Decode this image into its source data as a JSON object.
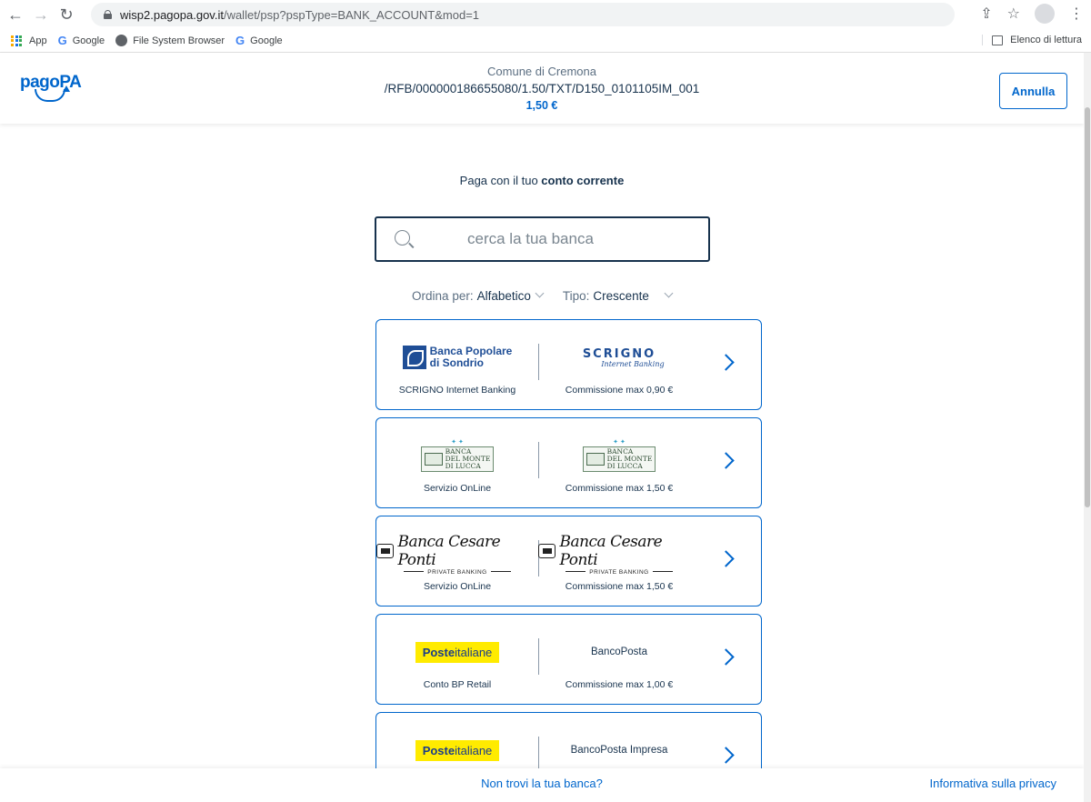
{
  "browser": {
    "url_host": "wisp2.pagopa.gov.it",
    "url_path": "/wallet/psp?pspType=BANK_ACCOUNT&mod=1",
    "bookmarks": [
      "App",
      "Google",
      "File System Browser",
      "Google"
    ],
    "reading_list": "Elenco di lettura"
  },
  "header": {
    "logo_text": "pagoPA",
    "entity": "Comune di Cremona",
    "subject": "/RFB/000000186655080/1.50/TXT/D150_0101105IM_001",
    "amount": "1,50 €",
    "cancel_label": "Annulla"
  },
  "intro": {
    "prefix": "Paga con il tuo ",
    "bold": "conto corrente"
  },
  "search": {
    "placeholder": "cerca la tua banca"
  },
  "sort": {
    "order_label": "Ordina per:",
    "order_value": "Alfabetico",
    "type_label": "Tipo:",
    "type_value": "Crescente"
  },
  "cards": [
    {
      "bank": "Banca Popolare di Sondrio",
      "bank_caption": "SCRIGNO Internet Banking",
      "service": "SCRIGNO Internet Banking",
      "fee": "Commissione max 0,90 €"
    },
    {
      "bank": "Banca del Monte di Lucca",
      "bank_caption": "Servizio OnLine",
      "service": "Banca del Monte di Lucca",
      "fee": "Commissione max 1,50 €"
    },
    {
      "bank": "Banca Cesare Ponti",
      "bank_caption": "Servizio OnLine",
      "service": "Banca Cesare Ponti",
      "fee": "Commissione max 1,50 €"
    },
    {
      "bank": "Posteitaliane",
      "bank_caption": "Conto BP Retail",
      "service": "BancoPosta",
      "fee": "Commissione max 1,00 €"
    },
    {
      "bank": "Posteitaliane",
      "bank_caption": "",
      "service": "BancoPosta Impresa",
      "fee": ""
    }
  ],
  "logos": {
    "bps_line1": "Banca Popolare",
    "bps_line2": "di Sondrio",
    "scrigno_word": "SCRIGNO",
    "scrigno_sub": "Internet Banking",
    "lucca_group": "GRUPPO BANCA CARIGE",
    "lucca_l1": "BANCA",
    "lucca_l2": "DEL MONTE",
    "lucca_l3": "DI LUCCA",
    "ponti_name": "Banca Cesare Ponti",
    "ponti_sub": "PRIVATE BANKING",
    "poste_bold": "Poste",
    "poste_rest": "italiane"
  },
  "footer": {
    "not_found": "Non trovi la tua banca?",
    "privacy": "Informativa sulla privacy"
  },
  "colors": {
    "brand": "#0066cc",
    "text": "#17324d",
    "poste_yellow": "#ffeb00"
  }
}
